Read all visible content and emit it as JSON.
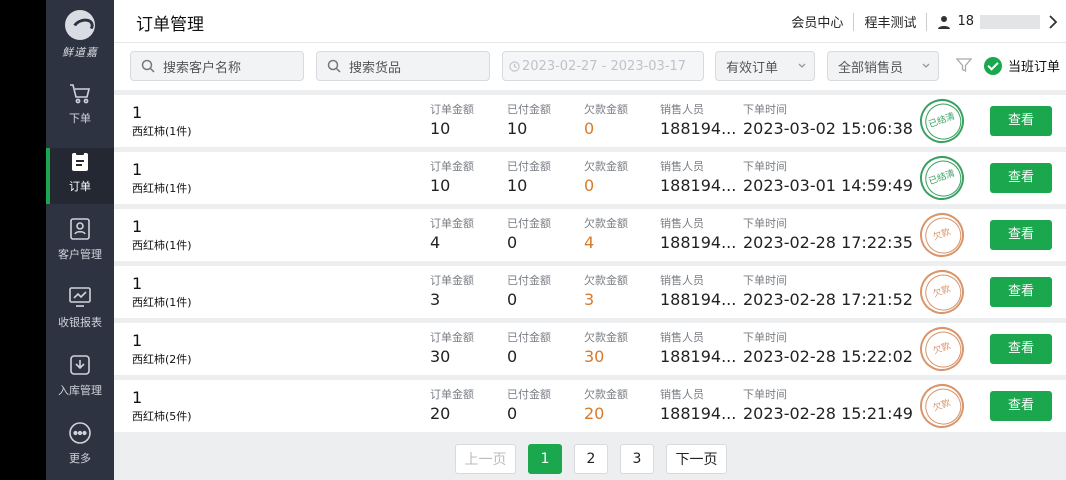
{
  "colors": {
    "accent": "#1aa74d",
    "sidebar_bg": "#2d3340",
    "owe": "#d87a2a"
  },
  "sidebar": {
    "brand": "鲜道嘉",
    "items": [
      {
        "label": "下单",
        "icon": "cart-icon"
      },
      {
        "label": "订单",
        "icon": "clipboard-icon",
        "active": true
      },
      {
        "label": "客户管理",
        "icon": "customer-icon"
      },
      {
        "label": "收银报表",
        "icon": "report-icon"
      },
      {
        "label": "入库管理",
        "icon": "inbound-icon"
      },
      {
        "label": "更多",
        "icon": "more-icon"
      }
    ]
  },
  "header": {
    "title": "订单管理",
    "member_center": "会员中心",
    "store_name": "程丰测试",
    "user_phone": "18"
  },
  "filters": {
    "customer_placeholder": "搜索客户名称",
    "goods_placeholder": "搜索货品",
    "date_range": "2023-02-27 - 2023-03-17",
    "order_status": "有效订单",
    "salesperson": "全部销售员",
    "shift_toggle": "当班订单"
  },
  "labels": {
    "order_amount": "订单金额",
    "paid_amount": "已付金额",
    "owed_amount": "欠款金额",
    "salesperson": "销售人员",
    "order_time": "下单时间",
    "view": "查看"
  },
  "orders": [
    {
      "qty": "1",
      "goods": "西红柿(1件)",
      "order_amount": "10",
      "paid": "10",
      "owed": "0",
      "salesperson": "188194...",
      "time": "2023-03-02 15:06:38",
      "stamp": "已结清"
    },
    {
      "qty": "1",
      "goods": "西红柿(1件)",
      "order_amount": "10",
      "paid": "10",
      "owed": "0",
      "salesperson": "188194...",
      "time": "2023-03-01 14:59:49",
      "stamp": "已结清"
    },
    {
      "qty": "1",
      "goods": "西红柿(1件)",
      "order_amount": "4",
      "paid": "0",
      "owed": "4",
      "salesperson": "188194...",
      "time": "2023-02-28 17:22:35",
      "stamp": "欠款"
    },
    {
      "qty": "1",
      "goods": "西红柿(1件)",
      "order_amount": "3",
      "paid": "0",
      "owed": "3",
      "salesperson": "188194...",
      "time": "2023-02-28 17:21:52",
      "stamp": "欠款"
    },
    {
      "qty": "1",
      "goods": "西红柿(2件)",
      "order_amount": "30",
      "paid": "0",
      "owed": "30",
      "salesperson": "188194...",
      "time": "2023-02-28 15:22:02",
      "stamp": "欠款"
    },
    {
      "qty": "1",
      "goods": "西红柿(5件)",
      "order_amount": "20",
      "paid": "0",
      "owed": "20",
      "salesperson": "188194...",
      "time": "2023-02-28 15:21:49",
      "stamp": "欠款"
    }
  ],
  "pagination": {
    "prev": "上一页",
    "pages": [
      "1",
      "2",
      "3"
    ],
    "current": "1",
    "next": "下一页"
  }
}
